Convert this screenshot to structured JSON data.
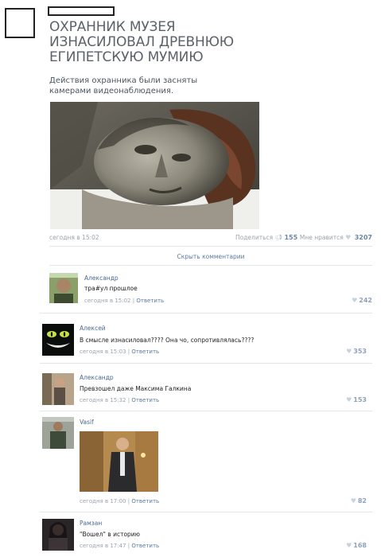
{
  "post": {
    "title": "ОХРАННИК МУЗЕЯ ИЗНАСИЛОВАЛ ДРЕВНЮЮ ЕГИПЕТСКУЮ МУМИЮ",
    "description": "Действия охранника были засняты камерами видеонаблюдения.",
    "date": "сегодня в 15:02",
    "share_label": "Поделиться",
    "share_count": "155",
    "likes_label": "Мне нравится",
    "likes_count": "3207"
  },
  "hide_comments_label": "Скрыть комментарии",
  "reply_label": "Ответить",
  "comments": [
    {
      "author": "Александр",
      "text": "тра#ул прошлое",
      "date": "сегодня в 15:02",
      "likes": "242"
    },
    {
      "author": "Алексей",
      "text": "В смысле изнасиловал???? Она чо, сопротивлялась????",
      "date": "сегодня в 15:03",
      "likes": "353"
    },
    {
      "author": "Александр",
      "text": "Превзошел даже Максима Галкина",
      "date": "сегодня в 15:32",
      "likes": "153"
    },
    {
      "author": "Vasif",
      "text": "",
      "date": "сегодня в 17:00",
      "likes": "82"
    },
    {
      "author": "Рамзан",
      "text": "\"Вошел\" в историю",
      "date": "сегодня в 17:47",
      "likes": "168"
    }
  ],
  "colors": {
    "link": "#4a6a90",
    "meta": "#9aa3ad",
    "title": "#5b6269"
  }
}
